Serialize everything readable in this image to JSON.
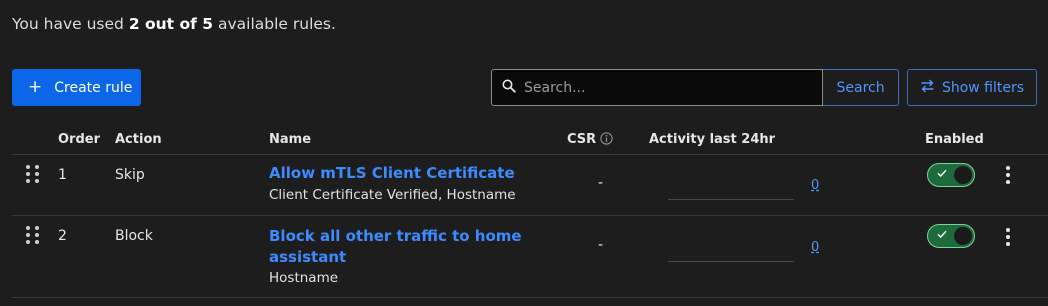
{
  "usage": {
    "prefix": "You have used ",
    "used": "2 out of 5",
    "suffix": " available rules."
  },
  "toolbar": {
    "create_label": "Create rule",
    "search_placeholder": "Search...",
    "search_button": "Search",
    "filters_label": "Show filters"
  },
  "table": {
    "headers": {
      "order": "Order",
      "action": "Action",
      "name": "Name",
      "csr": "CSR",
      "activity": "Activity last 24hr",
      "enabled": "Enabled"
    },
    "rows": [
      {
        "order": "1",
        "action": "Skip",
        "name": "Allow mTLS Client Certificate",
        "name_line2": "",
        "detail": "Client Certificate Verified, Hostname",
        "csr": "-",
        "activity": "0",
        "enabled": true
      },
      {
        "order": "2",
        "action": "Block",
        "name": "Block all other traffic to home",
        "name_line2": "assistant",
        "detail": "Hostname",
        "csr": "-",
        "activity": "0",
        "enabled": true
      }
    ]
  },
  "colors": {
    "accent": "#0b67e8",
    "link": "#3d8bff",
    "toggle_on": "#1d6b3a",
    "background": "#1d1d1d"
  },
  "icons": {
    "create": "plus-icon",
    "search": "search-icon",
    "filters": "swap-arrows-icon",
    "csr_info": "info-icon",
    "drag": "drag-handle-icon",
    "menu": "kebab-menu-icon",
    "toggle": "check-icon"
  }
}
